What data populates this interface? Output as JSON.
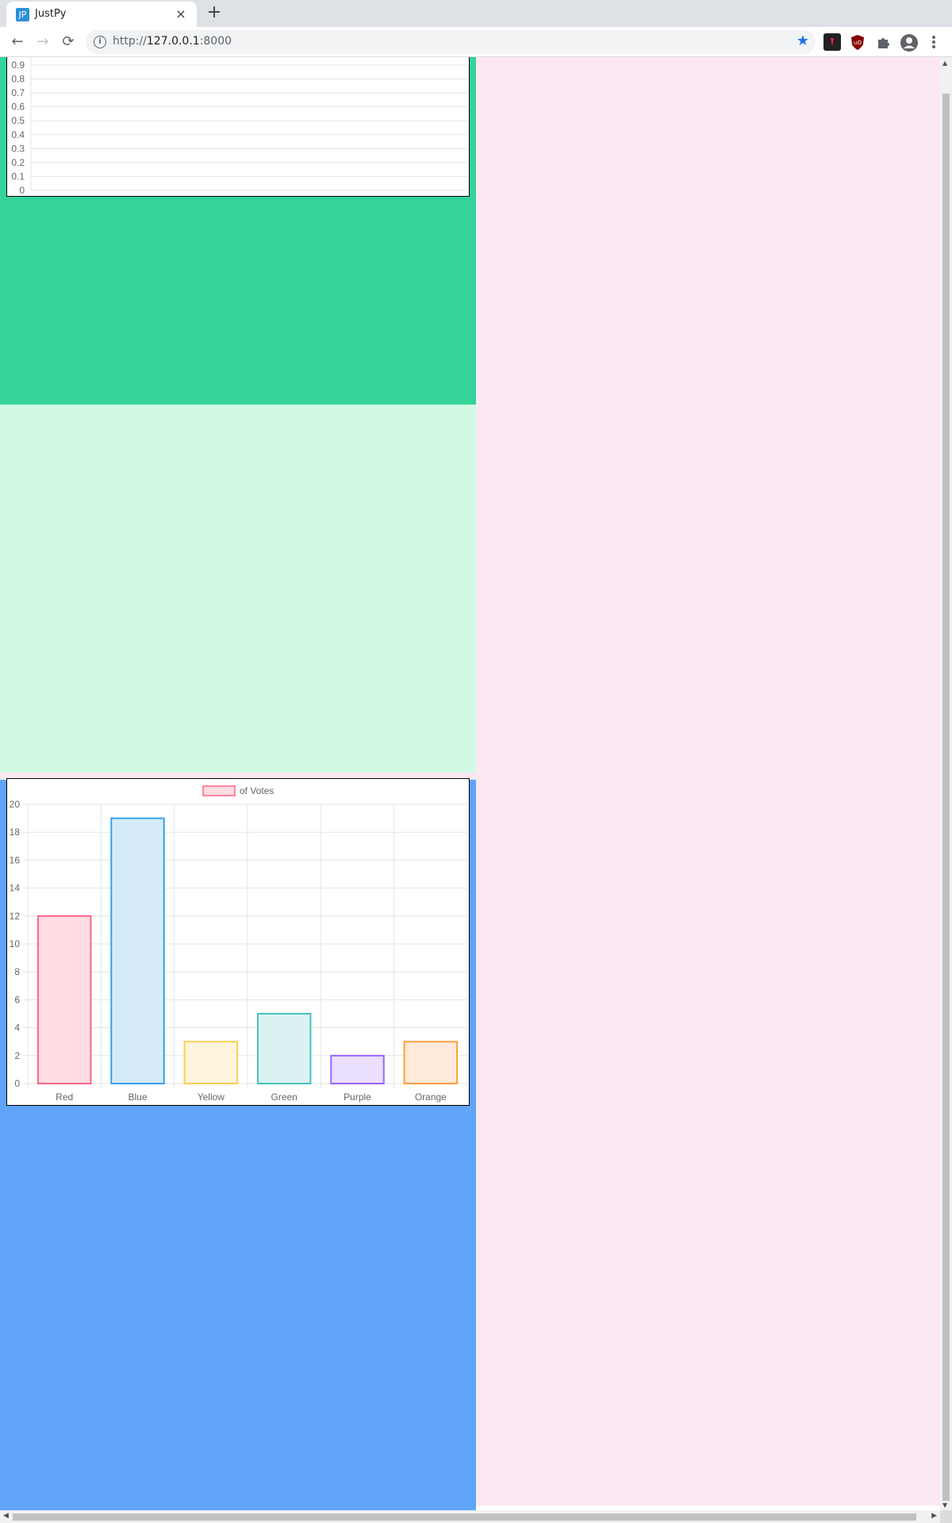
{
  "browser": {
    "tab_title": "JustPy",
    "tab_favicon_text": "JP",
    "tab_close_icon": "×",
    "new_tab_icon": "+",
    "url_scheme": "http://",
    "url_host": "127.0.0.1",
    "url_port": ":8000",
    "back_icon": "←",
    "forward_icon": "→",
    "reload_icon": "⟳",
    "star_icon": "★",
    "colors": {
      "star": "#1a73e8"
    }
  },
  "page": {
    "colors": {
      "green": "#34d399",
      "mint": "#d1fae5",
      "blue": "#60a5fa",
      "pink": "#fce7f3"
    }
  },
  "chart_data": [
    {
      "type": "line",
      "title": "",
      "xlabel": "",
      "ylabel": "",
      "y_ticks": [
        "0.9",
        "0.8",
        "0.7",
        "0.6",
        "0.5",
        "0.4",
        "0.3",
        "0.2",
        "0.1",
        "0"
      ],
      "ylim": [
        0,
        1
      ],
      "series": [],
      "grid": true,
      "note_visible": "chart is scrolled partially out of view at top; no data points visible"
    },
    {
      "type": "bar",
      "title": "",
      "legend": {
        "label": "of Votes",
        "placement": "top"
      },
      "categories": [
        "Red",
        "Blue",
        "Yellow",
        "Green",
        "Purple",
        "Orange"
      ],
      "values": [
        12,
        19,
        3,
        5,
        2,
        3
      ],
      "y_ticks": [
        "20",
        "18",
        "16",
        "14",
        "12",
        "10",
        "8",
        "6",
        "4",
        "2",
        "0"
      ],
      "ylim": [
        0,
        20
      ],
      "grid": true,
      "fill_colors": [
        "#ffdde3",
        "#d6ebf9",
        "#fff4dd",
        "#dbf2f2",
        "#ebe0ff",
        "#ffead9"
      ],
      "border_colors": [
        "#ff6384",
        "#36a2eb",
        "#ffce56",
        "#4bc0c0",
        "#9966ff",
        "#ff9f40"
      ]
    }
  ]
}
